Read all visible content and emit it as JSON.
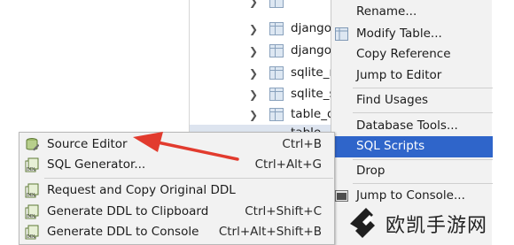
{
  "tree": {
    "rows": [
      {
        "label": "django_"
      },
      {
        "label": "django_"
      },
      {
        "label": "sqlite_m"
      },
      {
        "label": "sqlite_s"
      },
      {
        "label": "table_d"
      },
      {
        "label": "table"
      }
    ]
  },
  "context_menu": {
    "items": [
      {
        "label": "Rename..."
      },
      {
        "label": "Modify Table..."
      },
      {
        "label": "Copy Reference"
      },
      {
        "label": "Jump to Editor"
      },
      {
        "label": "Find Usages"
      },
      {
        "label": "Database Tools..."
      },
      {
        "label": "SQL Scripts"
      },
      {
        "label": "Drop"
      },
      {
        "label": "Jump to Console..."
      }
    ],
    "selected_color": "#2f65ca"
  },
  "submenu": {
    "items": [
      {
        "label": "Source Editor",
        "shortcut": "Ctrl+B"
      },
      {
        "label": "SQL Generator...",
        "shortcut": "Ctrl+Alt+G"
      },
      {
        "label": "Request and Copy Original DDL",
        "shortcut": ""
      },
      {
        "label": "Generate DDL to Clipboard",
        "shortcut": "Ctrl+Shift+C"
      },
      {
        "label": "Generate DDL to Console",
        "shortcut": "Ctrl+Alt+Shift+B"
      }
    ]
  },
  "annotation": {
    "arrow_color": "#e23b2e"
  },
  "watermark": {
    "text": "欧凯手游网"
  }
}
